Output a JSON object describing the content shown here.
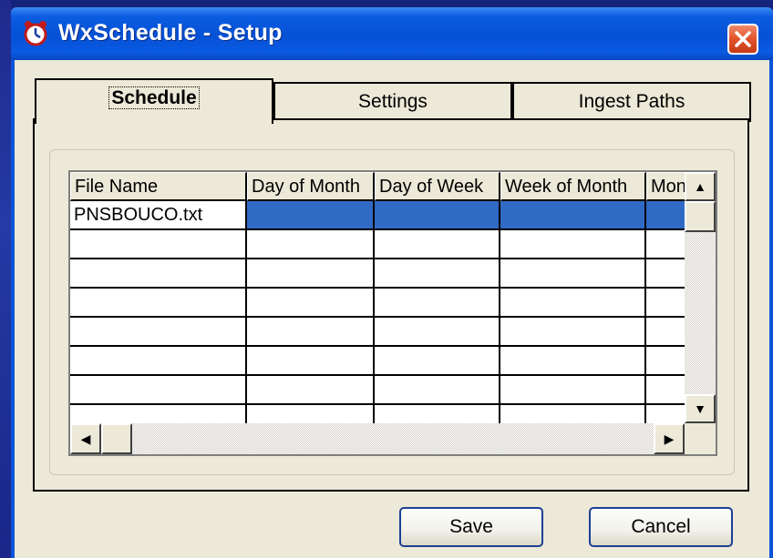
{
  "window": {
    "title": "WxSchedule - Setup"
  },
  "tabs": [
    {
      "label": "Schedule"
    },
    {
      "label": "Settings"
    },
    {
      "label": "Ingest Paths"
    }
  ],
  "grid": {
    "headers": [
      "File Name",
      "Day of Month",
      "Day of Week",
      "Week of Month",
      "Mon"
    ],
    "rows": [
      [
        "PNSBOUCO.txt",
        "",
        "",
        "",
        ""
      ]
    ]
  },
  "buttons": {
    "save": "Save",
    "cancel": "Cancel"
  },
  "colors": {
    "titlebar": "#0651d6",
    "selection": "#316ac5",
    "close": "#e2532b"
  }
}
